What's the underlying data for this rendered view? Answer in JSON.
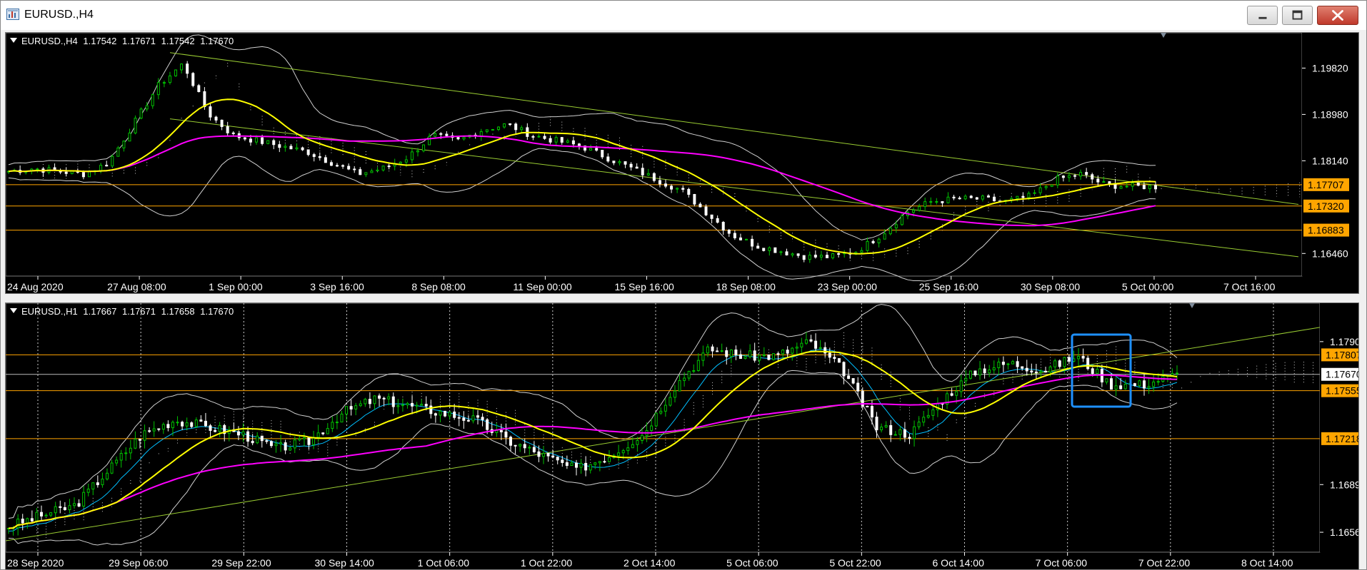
{
  "window": {
    "title": "EURUSD.,H4",
    "icons": [
      "chart-window-icon",
      "minimize-icon",
      "maximize-icon",
      "close-icon"
    ]
  },
  "colors": {
    "background": "#000000",
    "bull_candle": "#00c000",
    "bear_candle": "#ffffff",
    "moving_average_fast": "#ffff00",
    "moving_average_slow": "#ff00ff",
    "trendline": "#9acd32",
    "horizontal_level": "#ffa500",
    "bollinger": "#d0d0d0",
    "kijun": "#00bfff",
    "highlight_box": "#1e90ff"
  },
  "charts": [
    {
      "id": "h4",
      "header": {
        "symbol": "EURUSD.,H4",
        "open": "1.17542",
        "high": "1.17671",
        "low": "1.17542",
        "close": "1.17670"
      },
      "price_axis": [
        "1.19820",
        "1.18980",
        "1.18140",
        "1.16460"
      ],
      "price_tags": [
        {
          "value": "1.17707",
          "type": "level"
        },
        {
          "value": "1.17320",
          "type": "level"
        },
        {
          "value": "1.16883",
          "type": "level"
        }
      ],
      "time_axis": [
        "24 Aug 2020",
        "27 Aug 08:00",
        "1 Sep 00:00",
        "3 Sep 16:00",
        "8 Sep 08:00",
        "11 Sep 00:00",
        "15 Sep 16:00",
        "18 Sep 08:00",
        "23 Sep 00:00",
        "25 Sep 16:00",
        "30 Sep 08:00",
        "5 Oct 00:00",
        "7 Oct 16:00"
      ],
      "price_range": [
        1.1605,
        1.2033
      ],
      "chart_data": {
        "type": "candlestick",
        "close_path": [
          1.1795,
          1.18,
          1.1795,
          1.179,
          1.181,
          1.188,
          1.195,
          1.199,
          1.19,
          1.186,
          1.185,
          1.184,
          1.183,
          1.181,
          1.179,
          1.18,
          1.182,
          1.186,
          1.185,
          1.187,
          1.188,
          1.186,
          1.185,
          1.184,
          1.182,
          1.18,
          1.178,
          1.176,
          1.172,
          1.168,
          1.166,
          1.165,
          1.164,
          1.164,
          1.165,
          1.168,
          1.172,
          1.174,
          1.1745,
          1.1745,
          1.174,
          1.175,
          1.178,
          1.179,
          1.177,
          1.1768,
          1.1767
        ],
        "levels": [
          1.17707,
          1.1732,
          1.16883
        ]
      }
    },
    {
      "id": "h1",
      "header": {
        "symbol": "EURUSD.,H1",
        "open": "1.17667",
        "high": "1.17671",
        "low": "1.17658",
        "close": "1.17670"
      },
      "price_axis": [
        "1.17900",
        "1.16895",
        "1.16560"
      ],
      "price_tags": [
        {
          "value": "1.17807",
          "type": "level"
        },
        {
          "value": "1.17670",
          "type": "current"
        },
        {
          "value": "1.17555",
          "type": "level"
        },
        {
          "value": "1.17218",
          "type": "level"
        }
      ],
      "time_axis": [
        "28 Sep 2020",
        "29 Sep 06:00",
        "29 Sep 22:00",
        "30 Sep 14:00",
        "1 Oct 06:00",
        "1 Oct 22:00",
        "2 Oct 14:00",
        "5 Oct 06:00",
        "5 Oct 22:00",
        "6 Oct 14:00",
        "7 Oct 06:00",
        "7 Oct 22:00",
        "8 Oct 14:00"
      ],
      "price_range": [
        1.1642,
        1.1812
      ],
      "chart_data": {
        "type": "candlestick",
        "close_path": [
          1.166,
          1.1668,
          1.1675,
          1.17,
          1.1725,
          1.1735,
          1.173,
          1.1725,
          1.1715,
          1.172,
          1.174,
          1.175,
          1.1745,
          1.174,
          1.1735,
          1.172,
          1.171,
          1.17,
          1.171,
          1.1725,
          1.176,
          1.1785,
          1.178,
          1.178,
          1.179,
          1.177,
          1.173,
          1.1725,
          1.175,
          1.177,
          1.1775,
          1.177,
          1.178,
          1.176,
          1.176,
          1.1767
        ],
        "levels": [
          1.17807,
          1.1767,
          1.17555,
          1.17218
        ]
      }
    }
  ]
}
